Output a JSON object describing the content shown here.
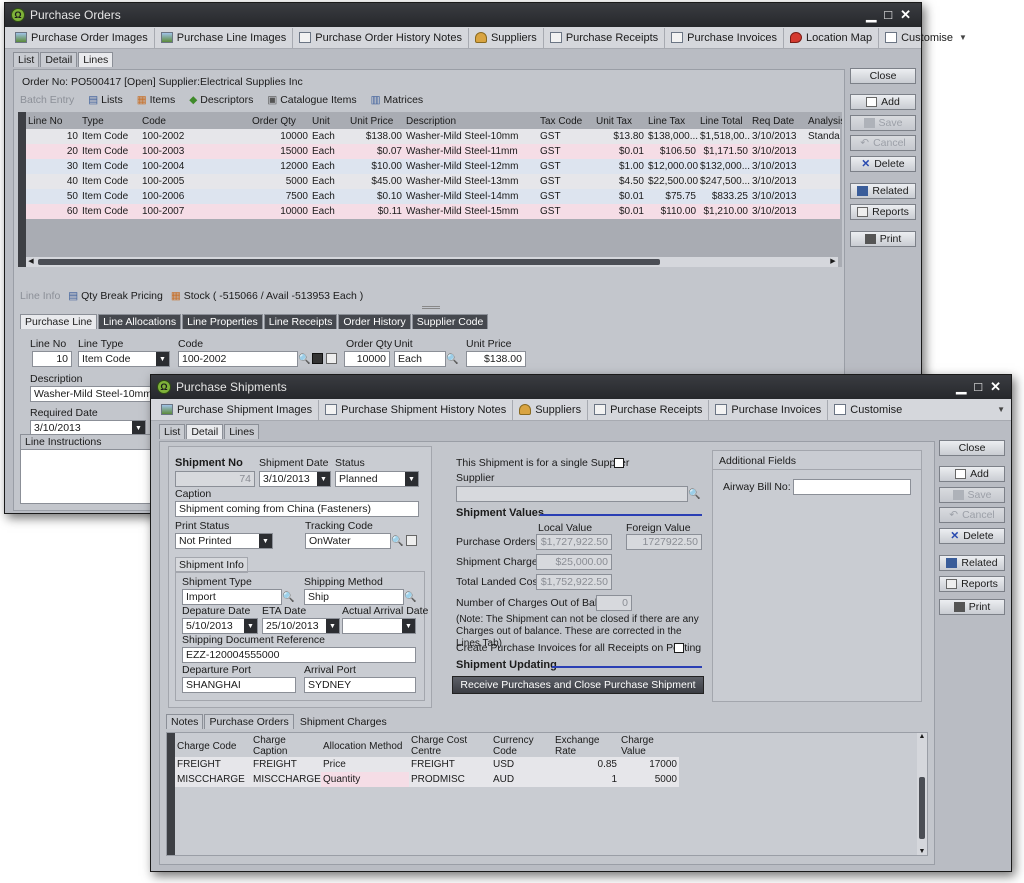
{
  "po": {
    "title": "Purchase Orders",
    "toolbar": [
      "Purchase Order Images",
      "Purchase Line Images",
      "Purchase Order History Notes",
      "Suppliers",
      "Purchase Receipts",
      "Purchase Invoices",
      "Location Map",
      "Customise"
    ],
    "tabs": [
      "List",
      "Detail",
      "Lines"
    ],
    "order_header": "Order No: PO500417 [Open] Supplier:Electrical Supplies Inc",
    "subtoolbar": [
      "Batch Entry",
      "Lists",
      "Items",
      "Descriptors",
      "Catalogue Items",
      "Matrices"
    ],
    "columns": [
      "Line No",
      "Type",
      "Code",
      "Order Qty",
      "Unit",
      "Unit Price",
      "Description",
      "Tax Code",
      "Unit Tax",
      "Line Tax",
      "Line Total",
      "Req Date",
      "Analysis"
    ],
    "rows": [
      [
        "10",
        "Item Code",
        "100-2002",
        "10000",
        "Each",
        "$138.00",
        "Washer-Mild Steel-10mm",
        "GST",
        "$13.80",
        "$138,000....",
        "$1,518,00...",
        "3/10/2013",
        "Standar"
      ],
      [
        "20",
        "Item Code",
        "100-2003",
        "15000",
        "Each",
        "$0.07",
        "Washer-Mild Steel-11mm",
        "GST",
        "$0.01",
        "$106.50",
        "$1,171.50",
        "3/10/2013",
        ""
      ],
      [
        "30",
        "Item Code",
        "100-2004",
        "12000",
        "Each",
        "$10.00",
        "Washer-Mild Steel-12mm",
        "GST",
        "$1.00",
        "$12,000.00",
        "$132,000....",
        "3/10/2013",
        ""
      ],
      [
        "40",
        "Item Code",
        "100-2005",
        "5000",
        "Each",
        "$45.00",
        "Washer-Mild Steel-13mm",
        "GST",
        "$4.50",
        "$22,500.00",
        "$247,500....",
        "3/10/2013",
        ""
      ],
      [
        "50",
        "Item Code",
        "100-2006",
        "7500",
        "Each",
        "$0.10",
        "Washer-Mild Steel-14mm",
        "GST",
        "$0.01",
        "$75.75",
        "$833.25",
        "3/10/2013",
        ""
      ],
      [
        "60",
        "Item Code",
        "100-2007",
        "10000",
        "Each",
        "$0.11",
        "Washer-Mild Steel-15mm",
        "GST",
        "$0.01",
        "$110.00",
        "$1,210.00",
        "3/10/2013",
        ""
      ]
    ],
    "lineinfo": [
      "Line Info",
      "Qty Break Pricing",
      "Stock ( -515066 / Avail -513953 Each )"
    ],
    "lower_tabs": [
      "Purchase Line",
      "Line Allocations",
      "Line Properties",
      "Line Receipts",
      "Order History",
      "Supplier Code"
    ],
    "fields": {
      "line_no_label": "Line No",
      "line_no": "10",
      "line_type_label": "Line Type",
      "line_type": "Item Code",
      "code_label": "Code",
      "code": "100-2002",
      "order_qty_label": "Order Qty",
      "order_qty": "10000",
      "unit_label": "Unit",
      "unit": "Each",
      "unit_price_label": "Unit Price",
      "unit_price": "$138.00",
      "description_label": "Description",
      "description": "Washer-Mild Steel-10mm",
      "required_date_label": "Required Date",
      "required_date": "3/10/2013",
      "line_instructions_label": "Line Instructions"
    },
    "side_buttons": [
      "Close",
      "Add",
      "Save",
      "Cancel",
      "Delete",
      "Related",
      "Reports",
      "Print"
    ]
  },
  "ps": {
    "title": "Purchase Shipments",
    "toolbar": [
      "Purchase Shipment Images",
      "Purchase Shipment History Notes",
      "Suppliers",
      "Purchase Receipts",
      "Purchase Invoices",
      "Customise"
    ],
    "tabs": [
      "List",
      "Detail",
      "Lines"
    ],
    "shipment_no_label": "Shipment No",
    "shipment_no": "74",
    "shipment_date_label": "Shipment Date",
    "shipment_date": "3/10/2013",
    "status_label": "Status",
    "status": "Planned",
    "caption_label": "Caption",
    "caption": "Shipment coming from China (Fasteners)",
    "print_status_label": "Print Status",
    "print_status": "Not Printed",
    "tracking_code_label": "Tracking Code",
    "tracking_code": "OnWater",
    "shipment_info_label": "Shipment Info",
    "shipment_type_label": "Shipment Type",
    "shipment_type": "Import",
    "shipping_method_label": "Shipping Method",
    "shipping_method": "Ship",
    "departure_date_label": "Depature Date",
    "departure_date": "5/10/2013",
    "eta_date_label": "ETA Date",
    "eta_date": "25/10/2013",
    "actual_arrival_label": "Actual Arrival Date",
    "actual_arrival": "",
    "ship_doc_ref_label": "Shipping Document Reference",
    "ship_doc_ref": "EZZ-120004555000",
    "departure_port_label": "Departure Port",
    "departure_port": "SHANGHAI",
    "arrival_port_label": "Arrival Port",
    "arrival_port": "SYDNEY",
    "single_supplier_label": "This Shipment is for a single Supplier",
    "supplier_label": "Supplier",
    "values_heading": "Shipment Values",
    "local_value_label": "Local Value",
    "foreign_value_label": "Foreign Value",
    "purchase_orders_label": "Purchase Orders",
    "purchase_orders_local": "$1,727,922.50",
    "purchase_orders_foreign": "1727922.50",
    "shipment_charges_label": "Shipment Charges",
    "shipment_charges_local": "$25,000.00",
    "total_landed_label": "Total Landed Cost",
    "total_landed_local": "$1,752,922.50",
    "charges_out_label": "Number of Charges Out of Balance",
    "charges_out": "0",
    "note": "(Note: The Shipment can not be closed if there are any Charges out of balance. These are corrected in the Lines Tab)",
    "create_invoices_label": "Create Purchase Invoices for all Receipts on Posting",
    "updating_heading": "Shipment Updating",
    "receive_button": "Receive Purchases and Close Purchase Shipment",
    "additional_fields_label": "Additional Fields",
    "airway_bill_label": "Airway Bill No:",
    "bottom_tabs": [
      "Notes",
      "Purchase Orders",
      "Shipment Charges"
    ],
    "charge_columns": [
      "Charge Code",
      "Charge Caption",
      "Allocation Method",
      "Charge Cost Centre",
      "Currency Code",
      "Exchange Rate",
      "Charge Value"
    ],
    "charge_rows": [
      [
        "FREIGHT",
        "FREIGHT",
        "Price",
        "FREIGHT",
        "USD",
        "0.85",
        "17000"
      ],
      [
        "MISCCHARGE",
        "MISCCHARGE",
        "Quantity",
        "PRODMISC",
        "AUD",
        "1",
        "5000"
      ]
    ],
    "side_buttons": [
      "Close",
      "Add",
      "Save",
      "Cancel",
      "Delete",
      "Related",
      "Reports",
      "Print"
    ]
  }
}
